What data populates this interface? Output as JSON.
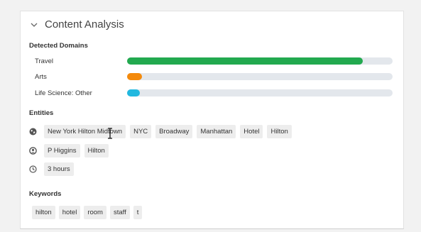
{
  "panel": {
    "title": "Content Analysis"
  },
  "domains": {
    "heading": "Detected Domains",
    "items": [
      {
        "label": "Travel",
        "percent": 88.8,
        "color": "#22a94f"
      },
      {
        "label": "Arts",
        "percent": 5.6,
        "color": "#f48a0c"
      },
      {
        "label": "Life Science: Other",
        "percent": 4.8,
        "color": "#22b8df"
      }
    ]
  },
  "entities": {
    "heading": "Entities",
    "groups": [
      {
        "icon": "globe-icon",
        "tags": [
          "New York Hilton Midtown",
          "NYC",
          "Broadway",
          "Manhattan",
          "Hotel",
          "Hilton"
        ]
      },
      {
        "icon": "user-circle-icon",
        "tags": [
          "P Higgins",
          "Hilton"
        ]
      },
      {
        "icon": "clock-icon",
        "tags": [
          "3 hours"
        ]
      }
    ]
  },
  "keywords": {
    "heading": "Keywords",
    "tags": [
      "hilton",
      "hotel",
      "room",
      "staff",
      "t"
    ]
  }
}
